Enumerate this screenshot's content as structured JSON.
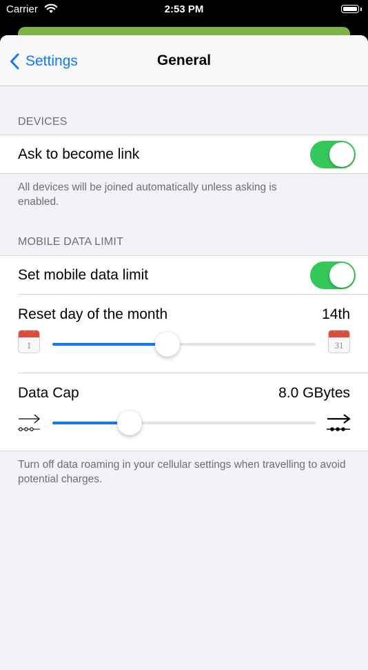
{
  "status_bar": {
    "carrier": "Carrier",
    "time": "2:53 PM"
  },
  "nav": {
    "back_label": "Settings",
    "title": "General"
  },
  "devices": {
    "header": "DEVICES",
    "ask_link_label": "Ask to become link",
    "ask_link_on": true,
    "footer": "All devices will be joined automatically unless asking is enabled."
  },
  "mobile_data": {
    "header": "MOBILE DATA LIMIT",
    "set_limit_label": "Set mobile data limit",
    "set_limit_on": true,
    "reset_day": {
      "label": "Reset day of the month",
      "value": "14th",
      "min_label": "1",
      "max_label": "31",
      "fraction": 0.437
    },
    "data_cap": {
      "label": "Data Cap",
      "value": "8.0 GBytes",
      "fraction": 0.292
    },
    "footer": "Turn off data roaming in your cellular settings when travelling to avoid potential charges."
  },
  "colors": {
    "accent": "#0a7aff",
    "toggle_on": "#34c759",
    "back_card": "#7db246",
    "calendar": "#e04a3a"
  },
  "icons": [
    "wifi-icon",
    "battery-icon",
    "back-chevron-icon",
    "calendar-start-icon",
    "calendar-end-icon",
    "range-min-icon",
    "range-max-icon"
  ]
}
